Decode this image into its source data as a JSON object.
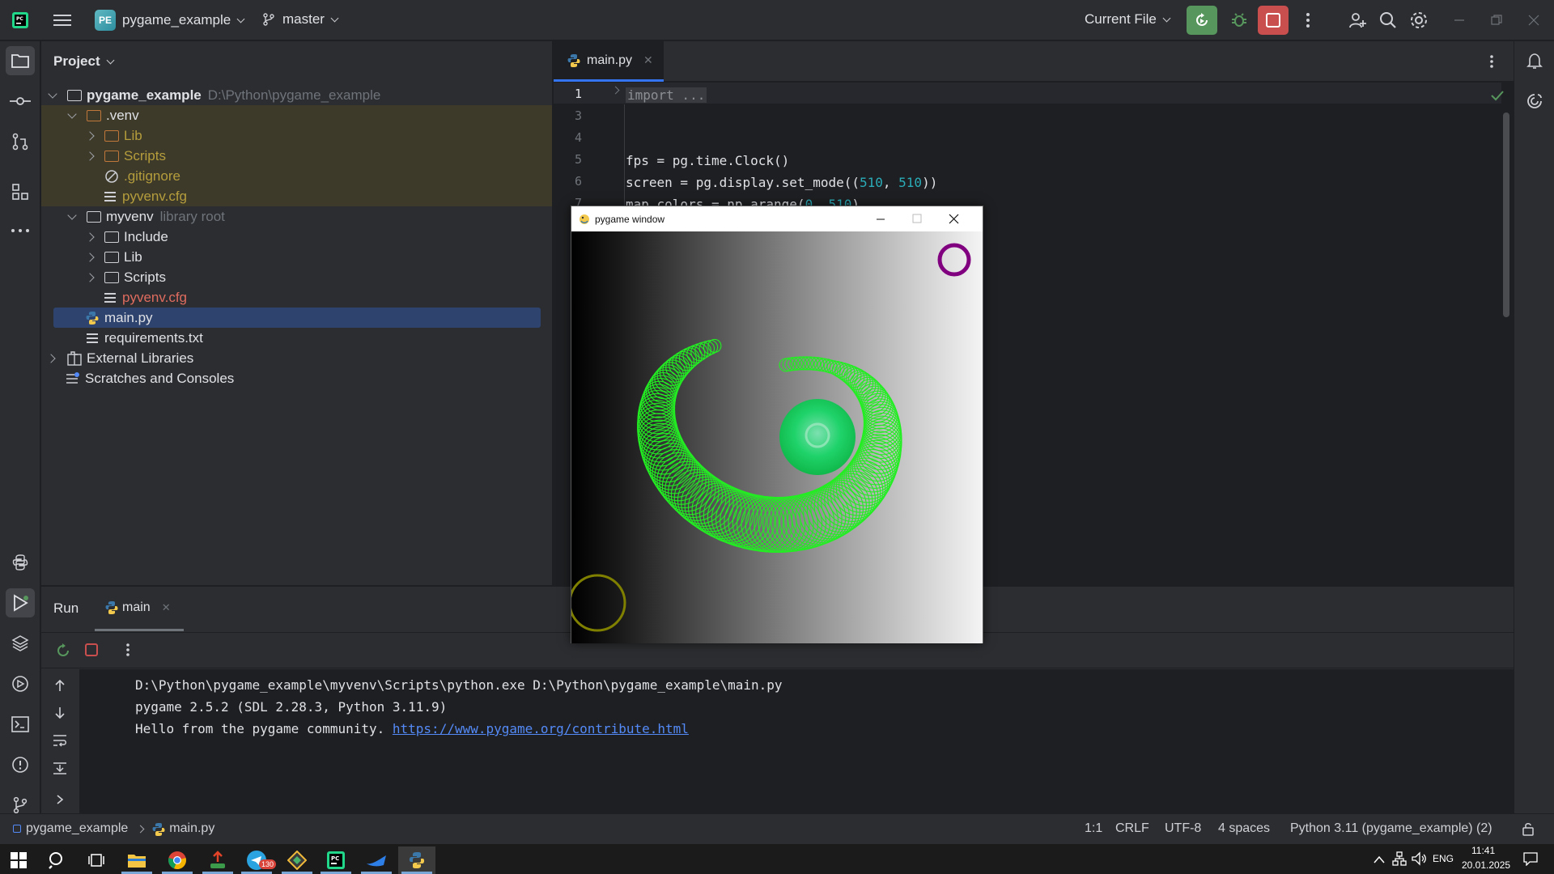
{
  "titlebar": {
    "project_badge": "PE",
    "project_name": "pygame_example",
    "branch": "master",
    "run_config": "Current File"
  },
  "project_panel": {
    "title": "Project",
    "tree": [
      {
        "label": "pygame_example",
        "hint": "D:\\Python\\pygame_example"
      },
      {
        "label": ".venv"
      },
      {
        "label": "Lib"
      },
      {
        "label": "Scripts"
      },
      {
        "label": ".gitignore"
      },
      {
        "label": "pyvenv.cfg"
      },
      {
        "label": "myvenv",
        "hint": "library root"
      },
      {
        "label": "Include"
      },
      {
        "label": "Lib"
      },
      {
        "label": "Scripts"
      },
      {
        "label": "pyvenv.cfg"
      },
      {
        "label": "main.py"
      },
      {
        "label": "requirements.txt"
      },
      {
        "label": "External Libraries"
      },
      {
        "label": "Scratches and Consoles"
      }
    ]
  },
  "editor": {
    "tab": "main.py",
    "lines": [
      {
        "n": "1",
        "code": "import ..."
      },
      {
        "n": "3",
        "code": ""
      },
      {
        "n": "4",
        "code": ""
      },
      {
        "n": "5",
        "code": "fps = pg.time.Clock()"
      },
      {
        "n": "6",
        "code": "screen = pg.display.set_mode((510, 510))"
      },
      {
        "n": "7",
        "code": "map_colors = np.arange(0, 510)"
      }
    ]
  },
  "pygame_window": {
    "title": "pygame window"
  },
  "run_panel": {
    "title": "Run",
    "tab": "main",
    "console": {
      "line1": "D:\\Python\\pygame_example\\myvenv\\Scripts\\python.exe D:\\Python\\pygame_example\\main.py",
      "line2": "pygame 2.5.2 (SDL 2.28.3, Python 3.11.9)",
      "line3_prefix": "Hello from the pygame community. ",
      "line3_link": "https://www.pygame.org/contribute.html"
    }
  },
  "statusbar": {
    "breadcrumb_project": "pygame_example",
    "breadcrumb_file": "main.py",
    "position": "1:1",
    "line_sep": "CRLF",
    "encoding": "UTF-8",
    "indent": "4 spaces",
    "interpreter": "Python 3.11 (pygame_example) (2)"
  },
  "taskbar": {
    "lang": "ENG",
    "time": "11:41",
    "date": "20.01.2025",
    "telegram_badge": "130"
  },
  "colors": {
    "accent": "#3574f0",
    "run_green": "#57965c",
    "stop_red": "#c94f4f",
    "ring_green": "#22ee22",
    "ring_purple": "#800080",
    "ring_olive": "#808000"
  }
}
